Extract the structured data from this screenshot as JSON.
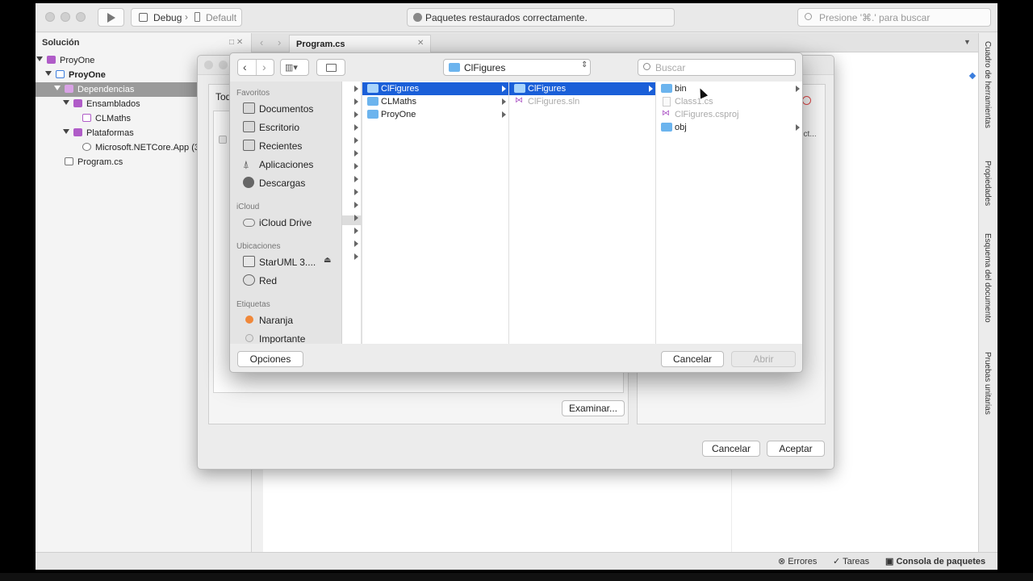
{
  "toolbar": {
    "config": "Debug",
    "target": "Default",
    "status": "Paquetes restaurados correctamente.",
    "search_placeholder": "Presione '⌘.' para buscar"
  },
  "solution": {
    "title": "Solución",
    "items": [
      {
        "label": "ProyOne"
      },
      {
        "label": "ProyOne"
      },
      {
        "label": "Dependencias"
      },
      {
        "label": "Ensamblados"
      },
      {
        "label": "CLMaths"
      },
      {
        "label": "Plataformas"
      },
      {
        "label": "Microsoft.NETCore.App (3.1..."
      },
      {
        "label": "Program.cs"
      }
    ]
  },
  "editor": {
    "tab": "Program.cs"
  },
  "rightbar": {
    "items": [
      "Cuadro de herramientas",
      "Propiedades",
      "Esquema del documento",
      "Pruebas unitarias"
    ]
  },
  "statusbar": {
    "errors": "Errores",
    "tasks": "Tareas",
    "console": "Consola de paquetes"
  },
  "bg_dialog": {
    "tab_partial": "Tod",
    "select_partial": "ect...",
    "browse": "Examinar...",
    "cancel": "Cancelar",
    "accept": "Aceptar"
  },
  "file_dialog": {
    "location": "ClFigures",
    "search_placeholder": "Buscar",
    "sidebar": {
      "favorites_head": "Favoritos",
      "favorites": [
        "Documentos",
        "Escritorio",
        "Recientes",
        "Aplicaciones",
        "Descargas"
      ],
      "icloud_head": "iCloud",
      "icloud": [
        "iCloud Drive"
      ],
      "locations_head": "Ubicaciones",
      "locations": [
        "StarUML 3....",
        "Red"
      ],
      "tags_head": "Etiquetas",
      "tags": [
        "Naranja",
        "Importante"
      ]
    },
    "col1": [
      "ClFigures",
      "CLMaths",
      "ProyOne"
    ],
    "col2": [
      "ClFigures",
      "ClFigures.sln"
    ],
    "col3": [
      "bin",
      "Class1.cs",
      "ClFigures.csproj",
      "obj"
    ],
    "options": "Opciones",
    "cancel": "Cancelar",
    "open": "Abrir"
  },
  "colors": {
    "selection": "#1a5fd8",
    "folder": "#6cb4ee",
    "project": "#b05cc8",
    "tag_orange": "#f0883a"
  }
}
